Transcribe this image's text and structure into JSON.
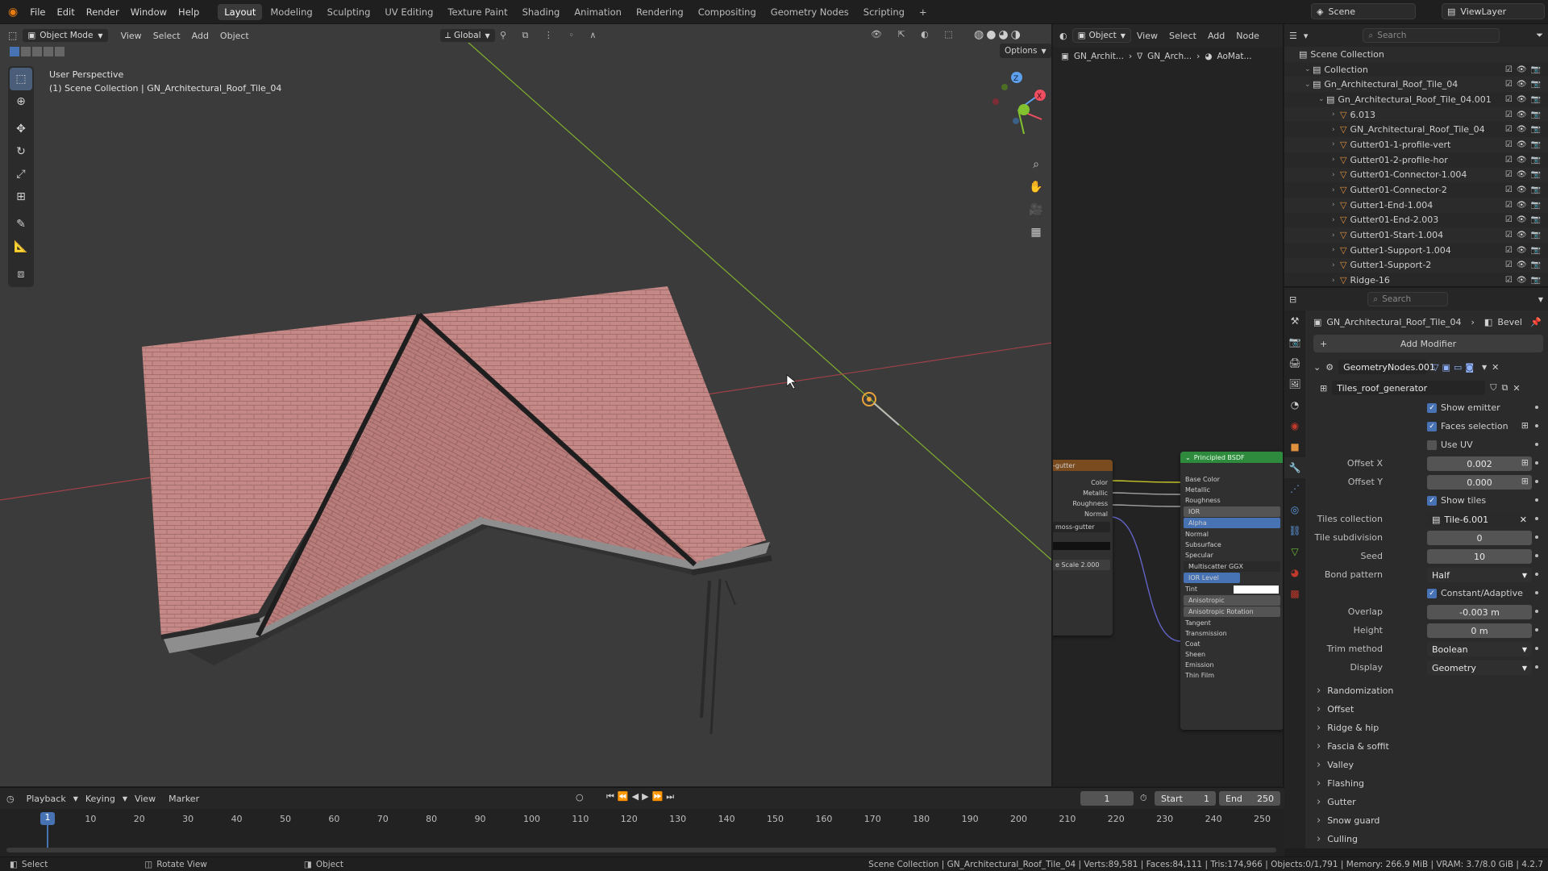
{
  "topbar": {
    "menus": [
      "File",
      "Edit",
      "Render",
      "Window",
      "Help"
    ],
    "workspaces": [
      "Layout",
      "Modeling",
      "Sculpting",
      "UV Editing",
      "Texture Paint",
      "Shading",
      "Animation",
      "Rendering",
      "Compositing",
      "Geometry Nodes",
      "Scripting"
    ],
    "active_workspace": "Layout",
    "scene": "Scene",
    "view_layer": "ViewLayer"
  },
  "viewport": {
    "mode": "Object Mode",
    "menus": [
      "View",
      "Select",
      "Add",
      "Object"
    ],
    "transform": "Global",
    "options": "Options",
    "perspective": "User Perspective",
    "collection_line": "(1) Scene Collection | GN_Architectural_Roof_Tile_04"
  },
  "nodes": {
    "mode": "Object",
    "menus": [
      "View",
      "Select",
      "Add",
      "Node"
    ],
    "breadcrumb": [
      "GN_Archit...",
      "GN_Arch...",
      "AoMat..."
    ],
    "left_node": {
      "title": "-gutter",
      "outputs": [
        "Color",
        "Metallic",
        "Roughness",
        "Normal"
      ],
      "image": "moss-gutter",
      "scale": "e Scale  2.000"
    },
    "bsdf": {
      "title": "Principled BSDF",
      "inputs": [
        "Base Color",
        "Metallic",
        "Roughness",
        "IOR",
        "Alpha",
        "Normal",
        "Subsurface",
        "Specular",
        "Multiscatter GGX",
        "IOR Level",
        "Tint",
        "Anisotropic",
        "Anisotropic Rotation",
        "Tangent",
        "Transmission",
        "Coat",
        "Sheen",
        "Emission",
        "Thin Film"
      ]
    }
  },
  "outliner": {
    "search_placeholder": "Search",
    "items": [
      {
        "label": "Scene Collection",
        "indent": 0
      },
      {
        "label": "Collection",
        "indent": 1
      },
      {
        "label": "Gn_Architectural_Roof_Tile_04",
        "indent": 1
      },
      {
        "label": "Gn_Architectural_Roof_Tile_04.001",
        "indent": 2
      },
      {
        "label": "6.013",
        "indent": 3
      },
      {
        "label": "GN_Architectural_Roof_Tile_04",
        "indent": 3
      },
      {
        "label": "Gutter01-1-profile-vert",
        "indent": 3
      },
      {
        "label": "Gutter01-2-profile-hor",
        "indent": 3
      },
      {
        "label": "Gutter01-Connector-1.004",
        "indent": 3
      },
      {
        "label": "Gutter01-Connector-2",
        "indent": 3
      },
      {
        "label": "Gutter1-End-1.004",
        "indent": 3
      },
      {
        "label": "Gutter01-End-2.003",
        "indent": 3
      },
      {
        "label": "Gutter01-Start-1.004",
        "indent": 3
      },
      {
        "label": "Gutter1-Support-1.004",
        "indent": 3
      },
      {
        "label": "Gutter1-Support-2",
        "indent": 3
      },
      {
        "label": "Ridge-16",
        "indent": 3
      }
    ]
  },
  "properties": {
    "search_placeholder": "Search",
    "object": "GN_Architectural_Roof_Tile_04",
    "modifier_crumb": "Bevel",
    "add_modifier": "Add Modifier",
    "modifier_name": "GeometryNodes.001",
    "node_group": "Tiles_roof_generator",
    "show_emitter": "Show emitter",
    "faces_selection": "Faces selection",
    "use_uv": "Use UV",
    "offset_x_label": "Offset X",
    "offset_x": "0.002",
    "offset_y_label": "Offset Y",
    "offset_y": "0.000",
    "show_tiles": "Show tiles",
    "tiles_collection_label": "Tiles collection",
    "tiles_collection": "Tile-6.001",
    "tile_subdivision_label": "Tile subdivision",
    "tile_subdivision": "0",
    "seed_label": "Seed",
    "seed": "10",
    "bond_pattern_label": "Bond pattern",
    "bond_pattern": "Half",
    "constant_adaptive": "Constant/Adaptive",
    "overlap_label": "Overlap",
    "overlap": "-0.003 m",
    "height_label": "Height",
    "height": "0 m",
    "trim_method_label": "Trim method",
    "trim_method": "Boolean",
    "display_label": "Display",
    "display": "Geometry",
    "panels": [
      "Randomization",
      "Offset",
      "Ridge & hip",
      "Fascia & soffit",
      "Valley",
      "Flashing",
      "Gutter",
      "Snow guard",
      "Culling"
    ]
  },
  "timeline": {
    "menus": [
      "Playback",
      "Keying",
      "View",
      "Marker"
    ],
    "current_frame": "1",
    "start_label": "Start",
    "start": "1",
    "end_label": "End",
    "end": "250",
    "ticks": [
      "10",
      "20",
      "30",
      "40",
      "50",
      "60",
      "70",
      "80",
      "90",
      "100",
      "110",
      "120",
      "130",
      "140",
      "150",
      "160",
      "170",
      "180",
      "190",
      "200",
      "210",
      "220",
      "230",
      "240",
      "250"
    ],
    "cursor": "1"
  },
  "status": {
    "select": "Select",
    "rotate": "Rotate View",
    "object": "Object",
    "stats": "Scene Collection | GN_Architectural_Roof_Tile_04 | Verts:89,581 | Faces:84,111 | Tris:174,966 | Objects:0/1,791 | Memory: 266.9 MiB | VRAM: 3.7/8.0 GiB | 4.2.7"
  },
  "colors": {
    "accent": "#4772b3",
    "roof": "#c48886",
    "x_axis": "#b8434a",
    "y_axis": "#7fae2f",
    "bsdf_header": "#2e8b3e"
  }
}
